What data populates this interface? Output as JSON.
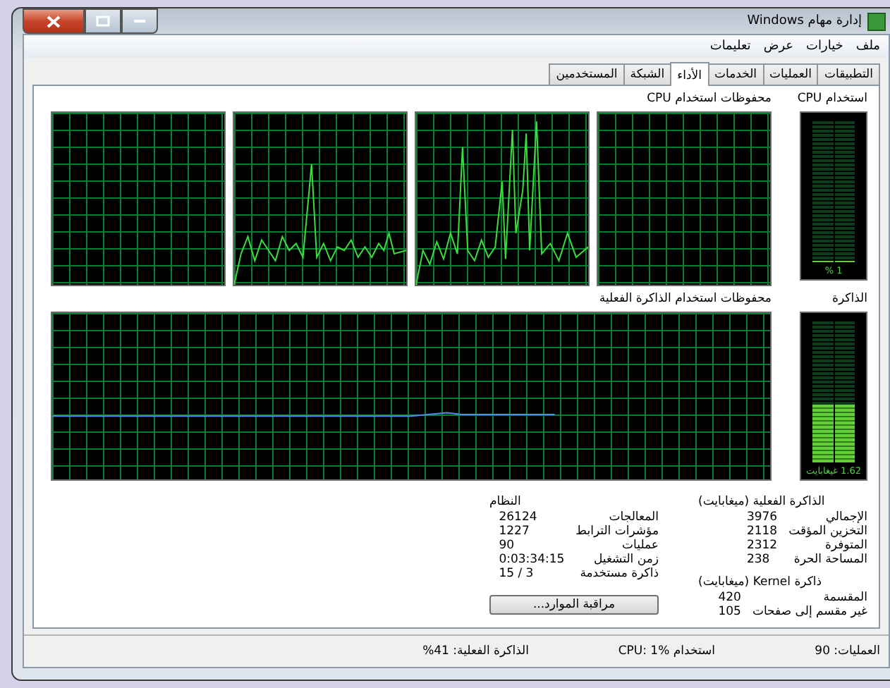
{
  "window": {
    "title": "إدارة مهام Windows"
  },
  "menu": [
    "ملف",
    "خيارات",
    "عرض",
    "تعليمات"
  ],
  "tabs": [
    {
      "label": "التطبيقات",
      "selected": false
    },
    {
      "label": "العمليات",
      "selected": false
    },
    {
      "label": "الخدمات",
      "selected": false
    },
    {
      "label": "الأداء",
      "selected": true
    },
    {
      "label": "الشبكة",
      "selected": false
    },
    {
      "label": "المستخدمين",
      "selected": false
    }
  ],
  "cpu": {
    "usage_label": "استخدام CPU",
    "level": 0.01,
    "reading": "1 %",
    "history_label": "محفوظات استخدام CPU"
  },
  "memory": {
    "usage_label": "الذاكرة",
    "level": 0.41,
    "reading": "1.62 غيغابايت",
    "history_label": "محفوظات استخدام الذاكرة الفعلية"
  },
  "physical_memory": {
    "title": "الذاكرة الفعلية (ميغابايت)",
    "rows": [
      {
        "label": "الإجمالي",
        "value": "3976"
      },
      {
        "label": "التخزين المؤقت",
        "value": "2118"
      },
      {
        "label": "المتوفرة",
        "value": "2312"
      },
      {
        "label": "المساحة الحرة",
        "value": "238"
      }
    ]
  },
  "kernel_memory": {
    "title": "ذاكرة Kernel (ميغابايت)",
    "rows": [
      {
        "label": "المقسمة",
        "value": "420"
      },
      {
        "label": "غير مقسم إلى صفحات",
        "value": "105"
      }
    ]
  },
  "system": {
    "title": "النظام",
    "rows": [
      {
        "label": "المعالجات",
        "value": "26124"
      },
      {
        "label": "مؤشرات الترابط",
        "value": "1227"
      },
      {
        "label": "عمليات",
        "value": "90"
      },
      {
        "label": "زمن التشغيل",
        "value": "0:03:34:15"
      },
      {
        "label": "ذاكرة مستخدمة",
        "value": "15 / 3"
      }
    ]
  },
  "resource_monitor_button": "مراقبة الموارد...",
  "status_bar": [
    "العمليات: 90",
    "استخدام CPU: 1%",
    "الذاكرة الفعلية: 41%"
  ]
}
